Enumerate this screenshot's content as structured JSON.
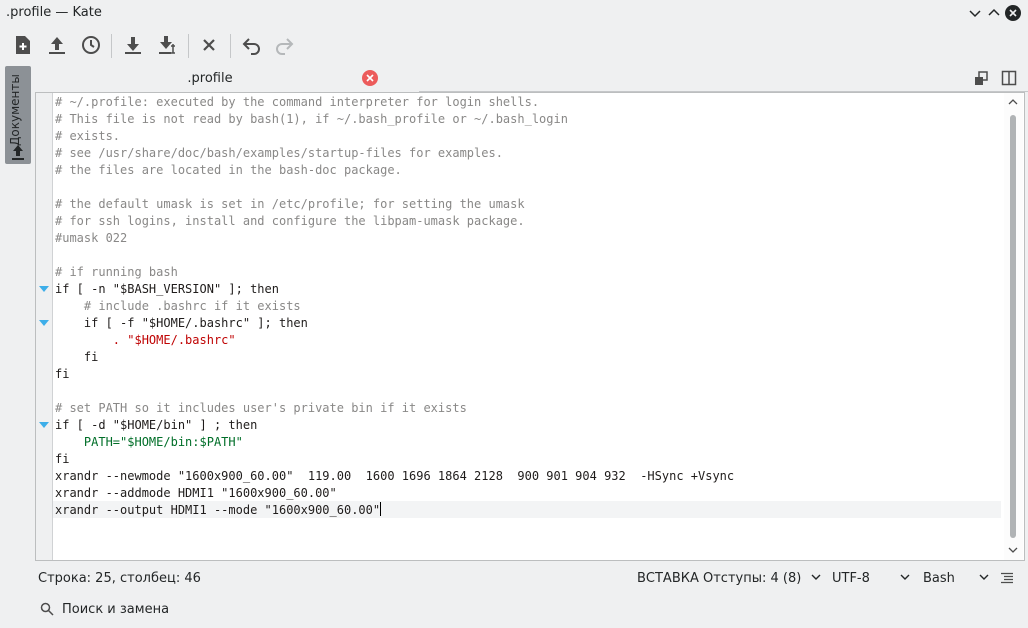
{
  "window": {
    "title": ".profile  — Kate"
  },
  "sidebar": {
    "documents_label": "Документы"
  },
  "tabs": [
    {
      "label": ".profile"
    }
  ],
  "editor": {
    "lines": [
      {
        "cls": "cmt",
        "text": "# ~/.profile: executed by the command interpreter for login shells."
      },
      {
        "cls": "cmt",
        "text": "# This file is not read by bash(1), if ~/.bash_profile or ~/.bash_login"
      },
      {
        "cls": "cmt",
        "text": "# exists."
      },
      {
        "cls": "cmt",
        "text": "# see /usr/share/doc/bash/examples/startup-files for examples."
      },
      {
        "cls": "cmt",
        "text": "# the files are located in the bash-doc package."
      },
      {
        "cls": "",
        "text": ""
      },
      {
        "cls": "cmt",
        "text": "# the default umask is set in /etc/profile; for setting the umask"
      },
      {
        "cls": "cmt",
        "text": "# for ssh logins, install and configure the libpam-umask package."
      },
      {
        "cls": "cmt",
        "text": "#umask 022"
      },
      {
        "cls": "",
        "text": ""
      },
      {
        "cls": "cmt",
        "text": "# if running bash"
      },
      {
        "cls": "kw",
        "text": "if [ -n \"$BASH_VERSION\" ]; then"
      },
      {
        "cls": "cmt",
        "text": "    # include .bashrc if it exists"
      },
      {
        "cls": "kw",
        "text": "    if [ -f \"$HOME/.bashrc\" ]; then"
      },
      {
        "cls": "str",
        "text": "        . \"$HOME/.bashrc\""
      },
      {
        "cls": "kw",
        "text": "    fi"
      },
      {
        "cls": "kw",
        "text": "fi"
      },
      {
        "cls": "",
        "text": ""
      },
      {
        "cls": "cmt",
        "text": "# set PATH so it includes user's private bin if it exists"
      },
      {
        "cls": "kw",
        "text": "if [ -d \"$HOME/bin\" ] ; then"
      },
      {
        "cls": "var",
        "text": "    PATH=\"$HOME/bin:$PATH\""
      },
      {
        "cls": "kw",
        "text": "fi"
      },
      {
        "cls": "kw",
        "text": "xrandr --newmode \"1600x900_60.00\"  119.00  1600 1696 1864 2128  900 901 904 932  -HSync +Vsync"
      },
      {
        "cls": "kw",
        "text": "xrandr --addmode HDMI1 \"1600x900_60.00\""
      },
      {
        "cls": "kw",
        "text": "xrandr --output HDMI1 --mode \"1600x900_60.00\""
      }
    ]
  },
  "status": {
    "position": "Строка: 25, столбец: 46",
    "mode": "ВСТАВКА",
    "indent": "Отступы: 4 (8)",
    "encoding": "UTF-8",
    "syntax": "Bash"
  },
  "search": {
    "label": "Поиск и замена"
  },
  "colors": {
    "accent": "#3daee9",
    "close": "#ec5b5b",
    "string": "#bf0303",
    "comment": "#898887",
    "variable": "#006e28"
  }
}
